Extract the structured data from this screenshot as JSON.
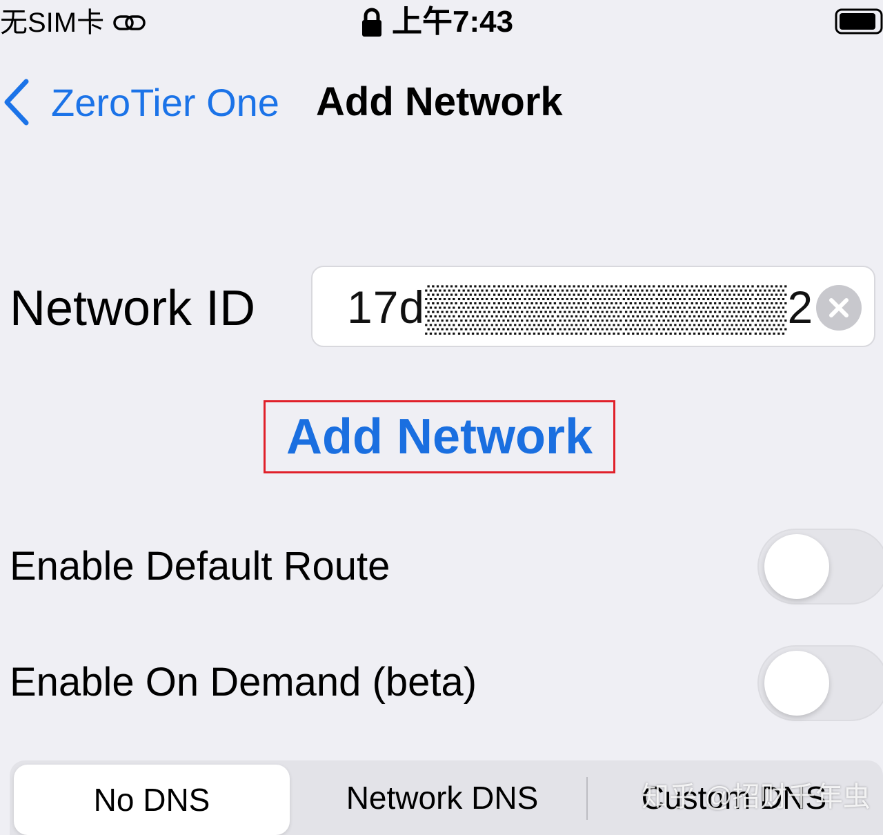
{
  "status_bar": {
    "carrier": "无SIM卡",
    "time": "上午7:43"
  },
  "nav": {
    "back_label": "ZeroTier One",
    "title": "Add Network"
  },
  "network_id": {
    "label": "Network ID",
    "value": "17d▒▒▒▒▒▒▒▒▒▒▒2"
  },
  "add_button": {
    "label": "Add Network"
  },
  "toggles": [
    {
      "label": "Enable Default Route",
      "on": false
    },
    {
      "label": "Enable On Demand (beta)",
      "on": false
    }
  ],
  "dns_segment": {
    "options": [
      "No DNS",
      "Network DNS",
      "Custom DNS"
    ],
    "selected": "No DNS"
  },
  "watermark": "知乎 @招财千年虫",
  "colors": {
    "accent": "#1a6fe0",
    "highlight_border": "#e0202a",
    "background": "#efeff4"
  }
}
